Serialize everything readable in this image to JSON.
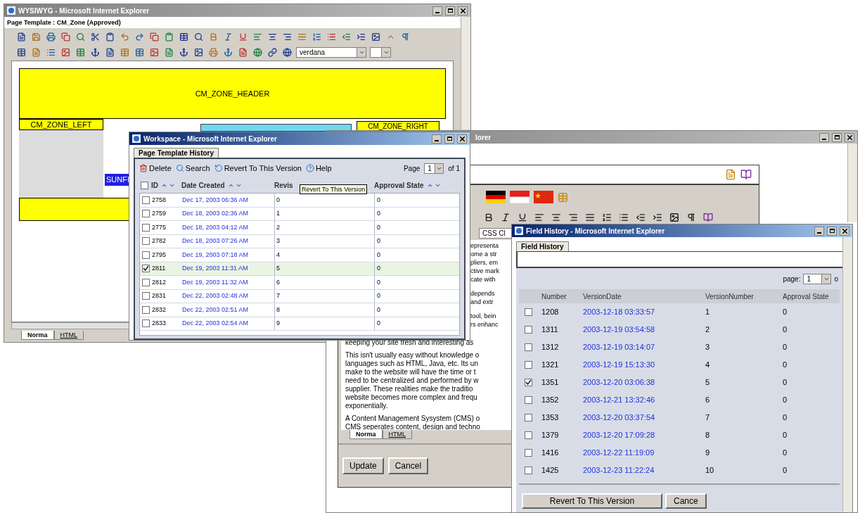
{
  "wysiwyg": {
    "title": "WYSIWYG - Microsoft Internet Explorer",
    "active": false,
    "page_template": "Page Template : CM_Zone (Approved)",
    "font_select": "verdana",
    "zones": {
      "header": "CM_ZONE_HEADER",
      "left": "CM_ZONE_LEFT",
      "right": "CM_ZONE_RIGHT",
      "selected_text": "SUNFI"
    },
    "tabs": [
      {
        "label": "Norma",
        "selected": true
      },
      {
        "label": "HTML",
        "selected": false
      }
    ]
  },
  "editor_window": {
    "title": "lorer",
    "active": false,
    "css_select": "CSS Cl",
    "text_fragments": [
      "epresenta",
      "ome a str",
      "pliers, em",
      "ctive mark",
      "cate with",
      "depends",
      "and extr",
      "tool, bein",
      "rs enhanc"
    ],
    "paragraphs": [
      [
        "keeping your site fresh and interesting as"
      ],
      [
        "This isn't usually easy without knowledge o",
        "languages such as HTML, Java, etc. Its un",
        "make to the website will have the time or t",
        "need to be centralized and performed by w",
        "supplier. These realities make the traditio",
        "website becomes more complex and frequ",
        "exponentially."
      ],
      [
        "A Content Management Sysystem (CMS) o",
        "CMS seperates content, design and techno"
      ]
    ],
    "tabs": [
      {
        "label": "Norma",
        "selected": true
      },
      {
        "label": "HTML",
        "selected": false
      }
    ],
    "buttons": [
      "Update",
      "Cancel"
    ]
  },
  "workspace": {
    "title": "Workspace - Microsoft Internet Explorer",
    "active": true,
    "tab": "Page Template History",
    "toolbar": [
      "Delete",
      "Search",
      "Revert To This Version",
      "Help"
    ],
    "page_label": "Page",
    "page_value": "1",
    "page_of": "of 1",
    "select_all_checked": false,
    "columns": [
      "ID",
      "Date Created",
      "Revis",
      "Approval State"
    ],
    "tooltip": "Revert To This Version",
    "rows": [
      {
        "id": "2758",
        "date": "Dec 17, 2003 06:36 AM",
        "revision": "0",
        "approval": "0",
        "checked": false
      },
      {
        "id": "2759",
        "date": "Dec 18, 2003 02:36 AM",
        "revision": "1",
        "approval": "0",
        "checked": false
      },
      {
        "id": "2775",
        "date": "Dec 18, 2003 04:12 AM",
        "revision": "2",
        "approval": "0",
        "checked": false
      },
      {
        "id": "2782",
        "date": "Dec 18, 2003 07:26 AM",
        "revision": "3",
        "approval": "0",
        "checked": false
      },
      {
        "id": "2795",
        "date": "Dec 19, 2003 07:18 AM",
        "revision": "4",
        "approval": "0",
        "checked": false
      },
      {
        "id": "2811",
        "date": "Dec 19, 2003 11:31 AM",
        "revision": "5",
        "approval": "0",
        "checked": true
      },
      {
        "id": "2812",
        "date": "Dec 19, 2003 11:32 AM",
        "revision": "6",
        "approval": "0",
        "checked": false
      },
      {
        "id": "2831",
        "date": "Dec 22, 2003 02:48 AM",
        "revision": "7",
        "approval": "0",
        "checked": false
      },
      {
        "id": "2832",
        "date": "Dec 22, 2003 02:51 AM",
        "revision": "8",
        "approval": "0",
        "checked": false
      },
      {
        "id": "2833",
        "date": "Dec 22, 2003 02:54 AM",
        "revision": "9",
        "approval": "0",
        "checked": false
      }
    ]
  },
  "field_history": {
    "title": "Field History - Microsoft Internet Explorer",
    "active": true,
    "tab": "Field History",
    "page_label": "page:",
    "page_value": "1",
    "page_of": "o",
    "columns": [
      "Number",
      "VersionDate",
      "VersionNumber",
      "Approval State"
    ],
    "rows": [
      {
        "number": "1208",
        "date": "2003-12-18 03:33:57",
        "version": "1",
        "approval": "0",
        "checked": false
      },
      {
        "number": "1311",
        "date": "2003-12-19 03:54:58",
        "version": "2",
        "approval": "0",
        "checked": false
      },
      {
        "number": "1312",
        "date": "2003-12-19 03:14:07",
        "version": "3",
        "approval": "0",
        "checked": false
      },
      {
        "number": "1321",
        "date": "2003-12-19 15:13:30",
        "version": "4",
        "approval": "0",
        "checked": false
      },
      {
        "number": "1351",
        "date": "2003-12-20 03:06:38",
        "version": "5",
        "approval": "0",
        "checked": true
      },
      {
        "number": "1352",
        "date": "2003-12-21 13:32:46",
        "version": "6",
        "approval": "0",
        "checked": false
      },
      {
        "number": "1353",
        "date": "2003-12-20 03:37:54",
        "version": "7",
        "approval": "0",
        "checked": false
      },
      {
        "number": "1379",
        "date": "2003-12-20 17:09:28",
        "version": "8",
        "approval": "0",
        "checked": false
      },
      {
        "number": "1416",
        "date": "2003-12-22 11:19:09",
        "version": "9",
        "approval": "0",
        "checked": false
      },
      {
        "number": "1425",
        "date": "2003-12-23 11:22:24",
        "version": "10",
        "approval": "0",
        "checked": false
      }
    ],
    "buttons": [
      "Revert To This Version",
      "Cance"
    ]
  }
}
